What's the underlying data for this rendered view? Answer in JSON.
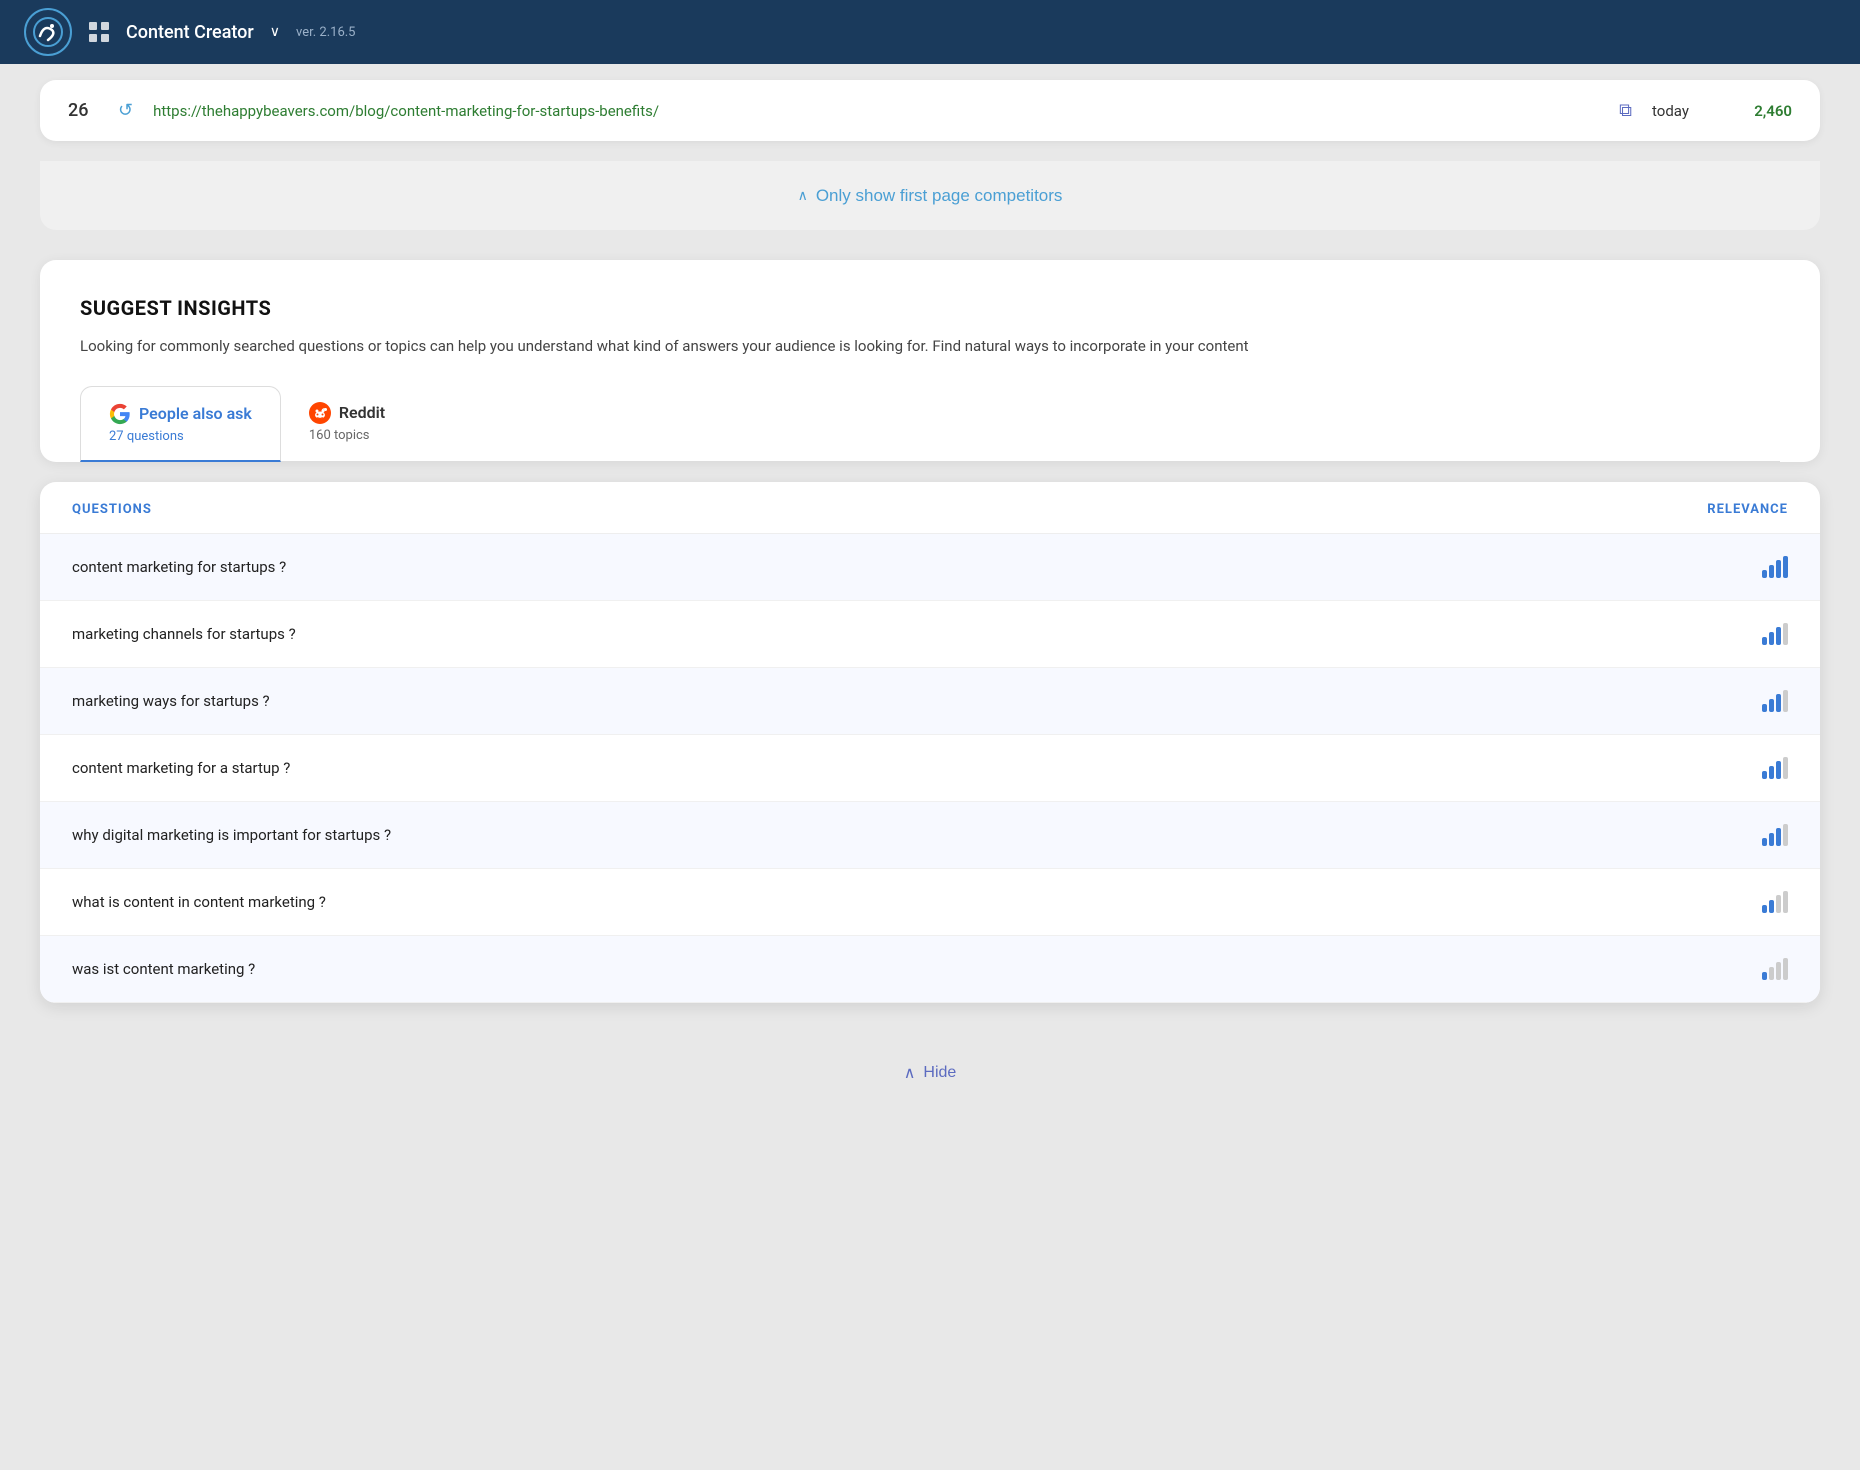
{
  "header": {
    "app_name": "Content Creator",
    "version": "ver. 2.16.5",
    "logo_text": "🐦",
    "grid_icon": "⊞",
    "chevron": "∨"
  },
  "url_row": {
    "number": "26",
    "arrow": "↺",
    "url": "https://thehappybeavers.com/blog/content-marketing-for-startups-benefits/",
    "date": "today",
    "count": "2,460"
  },
  "competitors": {
    "button_label": "Only show first page competitors"
  },
  "insights": {
    "title": "SUGGEST INSIGHTS",
    "description": "Looking for commonly searched questions or topics can help you understand what kind of answers your audience is looking for. Find natural ways to incorporate in your content"
  },
  "tabs": [
    {
      "id": "people-also-ask",
      "label": "People also ask",
      "count": "27 questions",
      "active": true
    },
    {
      "id": "reddit",
      "label": "Reddit",
      "count": "160 topics",
      "active": false
    }
  ],
  "questions_header": {
    "questions_label": "QUESTIONS",
    "relevance_label": "RELEVANCE"
  },
  "questions": [
    {
      "text": "content marketing for startups ?",
      "bars": [
        true,
        true,
        true,
        true
      ]
    },
    {
      "text": "marketing channels for startups ?",
      "bars": [
        true,
        true,
        true,
        false
      ]
    },
    {
      "text": "marketing ways for startups ?",
      "bars": [
        true,
        true,
        true,
        false
      ]
    },
    {
      "text": "content marketing for a startup ?",
      "bars": [
        true,
        true,
        true,
        false
      ]
    },
    {
      "text": "why digital marketing is important for startups ?",
      "bars": [
        true,
        true,
        true,
        false
      ]
    },
    {
      "text": "what is content in content marketing ?",
      "bars": [
        true,
        true,
        false,
        false
      ]
    },
    {
      "text": "was ist content marketing ?",
      "bars": [
        true,
        false,
        false,
        false
      ]
    }
  ],
  "hide_button": {
    "label": "Hide",
    "chevron": "∧"
  }
}
